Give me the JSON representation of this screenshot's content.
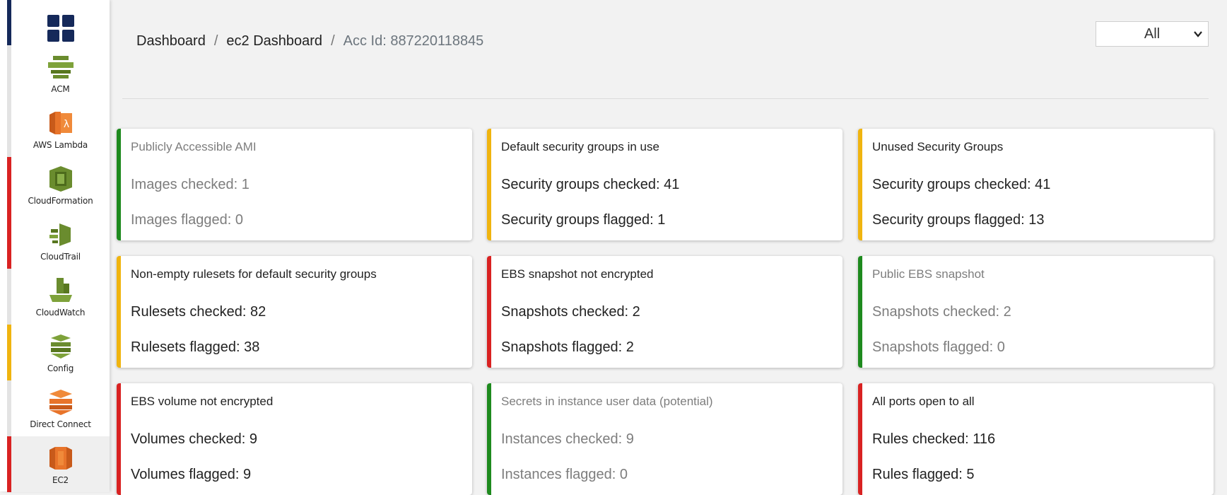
{
  "colors": {
    "green": "#1e8a1e",
    "yellow": "#f0b40f",
    "red": "#d92222",
    "navy": "#15295a",
    "aws_green": "#6a8c2e",
    "aws_orange": "#e8742a"
  },
  "sidebar": {
    "items": [
      {
        "icon": "dashboard-grid-icon",
        "label": "",
        "status": "navy"
      },
      {
        "icon": "acm-icon",
        "label": "ACM",
        "status": "none"
      },
      {
        "icon": "aws-lambda-icon",
        "label": "AWS Lambda",
        "status": "none"
      },
      {
        "icon": "cloudformation-icon",
        "label": "CloudFormation",
        "status": "red"
      },
      {
        "icon": "cloudtrail-icon",
        "label": "CloudTrail",
        "status": "red"
      },
      {
        "icon": "cloudwatch-icon",
        "label": "CloudWatch",
        "status": "none"
      },
      {
        "icon": "config-icon",
        "label": "Config",
        "status": "yellow"
      },
      {
        "icon": "direct-connect-icon",
        "label": "Direct Connect",
        "status": "none"
      },
      {
        "icon": "ec2-icon",
        "label": "EC2",
        "status": "red",
        "active": true
      }
    ]
  },
  "header": {
    "breadcrumb": [
      "Dashboard",
      "ec2 Dashboard",
      "Acc Id: 887220118845"
    ],
    "separator": "/",
    "filter": {
      "selected": "All",
      "icon": "chevron-down-icon"
    }
  },
  "cards": [
    {
      "title": "Publicly Accessible AMI",
      "line1": "Images checked: 1",
      "line2": "Images flagged: 0",
      "status": "green"
    },
    {
      "title": "Default security groups in use",
      "line1": "Security groups checked: 41",
      "line2": "Security groups flagged: 1",
      "status": "yellow"
    },
    {
      "title": "Unused Security Groups",
      "line1": "Security groups checked: 41",
      "line2": "Security groups flagged: 13",
      "status": "yellow"
    },
    {
      "title": "Non-empty rulesets for default security groups",
      "line1": "Rulesets checked: 82",
      "line2": "Rulesets flagged: 38",
      "status": "yellow"
    },
    {
      "title": "EBS snapshot not encrypted",
      "line1": "Snapshots checked: 2",
      "line2": "Snapshots flagged: 2",
      "status": "red"
    },
    {
      "title": "Public EBS snapshot",
      "line1": "Snapshots checked: 2",
      "line2": "Snapshots flagged: 0",
      "status": "green"
    },
    {
      "title": "EBS volume not encrypted",
      "line1": "Volumes checked: 9",
      "line2": "Volumes flagged: 9",
      "status": "red"
    },
    {
      "title": "Secrets in instance user data (potential)",
      "line1": "Instances checked: 9",
      "line2": "Instances flagged: 0",
      "status": "green"
    },
    {
      "title": "All ports open to all",
      "line1": "Rules checked: 116",
      "line2": "Rules flagged: 5",
      "status": "red"
    }
  ]
}
